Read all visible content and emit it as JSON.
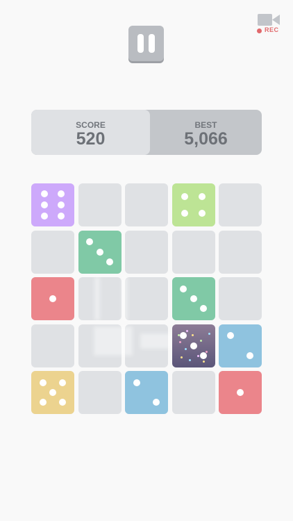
{
  "pause_icon": "pause-icon",
  "record": {
    "icon": "video-camera-icon",
    "label": "REC",
    "label_color": "#e1696c",
    "icon_color": "#c2c5ca"
  },
  "score": {
    "label": "SCORE",
    "value": "520"
  },
  "best": {
    "label": "BEST",
    "value": "5,066"
  },
  "colors": {
    "background": "#f9f9f9",
    "empty_cell": "#dfe1e4",
    "purple": "#cda9fb",
    "lime": "#bde495",
    "green": "#80c9a6",
    "red": "#eb858b",
    "blue": "#8fc3df",
    "yellow": "#ecd38f",
    "cosmic_top": "#8d7c96",
    "cosmic_bottom": "#5b5679"
  },
  "board": {
    "rows": 5,
    "cols": 5,
    "dice": [
      {
        "row": 0,
        "col": 0,
        "value": 6,
        "color": "purple"
      },
      {
        "row": 0,
        "col": 3,
        "value": 4,
        "color": "lime"
      },
      {
        "row": 1,
        "col": 1,
        "value": 3,
        "color": "green"
      },
      {
        "row": 2,
        "col": 0,
        "value": 1,
        "color": "red"
      },
      {
        "row": 2,
        "col": 3,
        "value": 3,
        "color": "green"
      },
      {
        "row": 3,
        "col": 3,
        "value": 3,
        "color": "cosmic",
        "special": true
      },
      {
        "row": 3,
        "col": 4,
        "value": 2,
        "color": "blue"
      },
      {
        "row": 4,
        "col": 0,
        "value": 5,
        "color": "yellow"
      },
      {
        "row": 4,
        "col": 2,
        "value": 2,
        "color": "blue"
      },
      {
        "row": 4,
        "col": 4,
        "value": 1,
        "color": "red"
      }
    ]
  }
}
